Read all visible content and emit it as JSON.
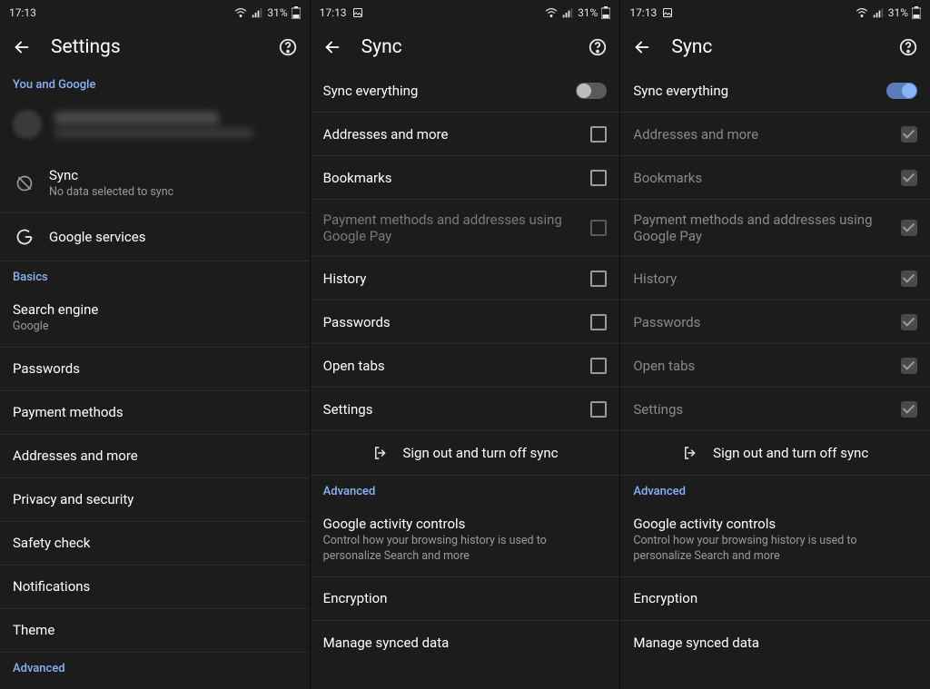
{
  "status": {
    "time": "17:13",
    "battery": "31%"
  },
  "panel1": {
    "title": "Settings",
    "section_you": "You and Google",
    "sync": {
      "title": "Sync",
      "sub": "No data selected to sync"
    },
    "google_services": "Google services",
    "section_basics": "Basics",
    "search_engine": {
      "title": "Search engine",
      "sub": "Google"
    },
    "passwords": "Passwords",
    "payment_methods": "Payment methods",
    "addresses": "Addresses and more",
    "privacy": "Privacy and security",
    "safety": "Safety check",
    "notifications": "Notifications",
    "theme": "Theme",
    "section_advanced": "Advanced"
  },
  "panel2": {
    "title": "Sync",
    "sync_everything_on": false,
    "items": {
      "sync_everything": "Sync everything",
      "addresses": "Addresses and more",
      "bookmarks": "Bookmarks",
      "payment_google_pay": "Payment methods and addresses using Google Pay",
      "history": "History",
      "passwords": "Passwords",
      "open_tabs": "Open tabs",
      "settings": "Settings"
    },
    "sign_out": "Sign out and turn off sync",
    "section_advanced": "Advanced",
    "activity": {
      "title": "Google activity controls",
      "sub": "Control how your browsing history is used to personalize Search and more"
    },
    "encryption": "Encryption",
    "manage_synced": "Manage synced data"
  },
  "panel3": {
    "title": "Sync",
    "sync_everything_on": true,
    "items": {
      "sync_everything": "Sync everything",
      "addresses": "Addresses and more",
      "bookmarks": "Bookmarks",
      "payment_google_pay": "Payment methods and addresses using Google Pay",
      "history": "History",
      "passwords": "Passwords",
      "open_tabs": "Open tabs",
      "settings": "Settings"
    },
    "sign_out": "Sign out and turn off sync",
    "section_advanced": "Advanced",
    "activity": {
      "title": "Google activity controls",
      "sub": "Control how your browsing history is used to personalize Search and more"
    },
    "encryption": "Encryption",
    "manage_synced": "Manage synced data"
  }
}
